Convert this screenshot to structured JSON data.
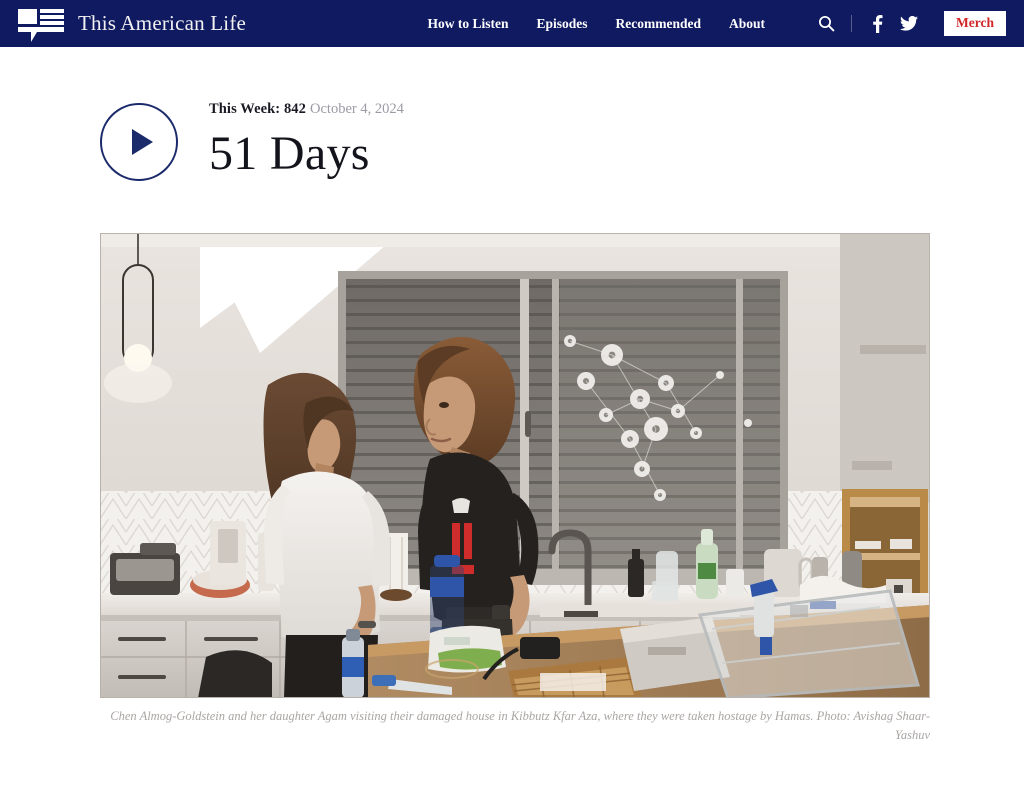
{
  "header": {
    "brand_name": "This American Life",
    "logo_icon": "speech-bubble-logo",
    "nav": [
      {
        "label": "How to Listen"
      },
      {
        "label": "Episodes"
      },
      {
        "label": "Recommended"
      },
      {
        "label": "About"
      }
    ],
    "search_icon": "search-icon",
    "facebook_icon": "facebook-icon",
    "twitter_icon": "twitter-icon",
    "merch_label": "Merch",
    "colors": {
      "navy": "#0f1a61",
      "merch_text": "#d0272a",
      "merch_bg": "#ffffff"
    }
  },
  "episode": {
    "play_icon": "play-icon",
    "week_label": "This Week: 842",
    "date": "October 4, 2024",
    "title": "51 Days"
  },
  "hero": {
    "caption_line1": "Chen Almog-Goldstein and her daughter Agam visiting their damaged house in Kibbutz Kfar Aza, where they were taken hostage by Hamas. Photo: Avishag",
    "caption_line2": "Shaar-Yashuv",
    "alt": "Two women standing in a damaged kitchen with bullet-marked window"
  }
}
